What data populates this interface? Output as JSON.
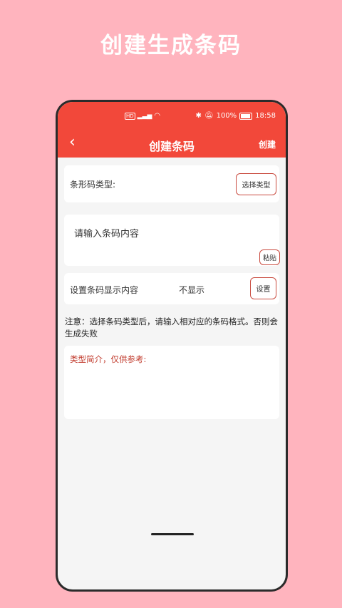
{
  "promo": {
    "title": "创建生成条码"
  },
  "status_bar": {
    "time": "18:58",
    "battery": "100%",
    "signal_text": "HD"
  },
  "nav": {
    "back_icon": "‹",
    "title": "创建条码",
    "create_label": "创建"
  },
  "barcode_type": {
    "label": "条形码类型:",
    "button_label": "选择类型"
  },
  "content_input": {
    "placeholder": "请输入条码内容",
    "paste_label": "粘贴"
  },
  "display_setting": {
    "label": "设置条码显示内容",
    "value": "不显示",
    "button_label": "设置"
  },
  "note": {
    "text": "注意：选择条码类型后，请输入相对应的条码格式。否则会生成失败"
  },
  "type_intro": {
    "label": "类型简介，仅供参考:"
  },
  "colors": {
    "accent": "#f2483a",
    "background": "#ffb4be",
    "intro_text": "#c0392b"
  }
}
